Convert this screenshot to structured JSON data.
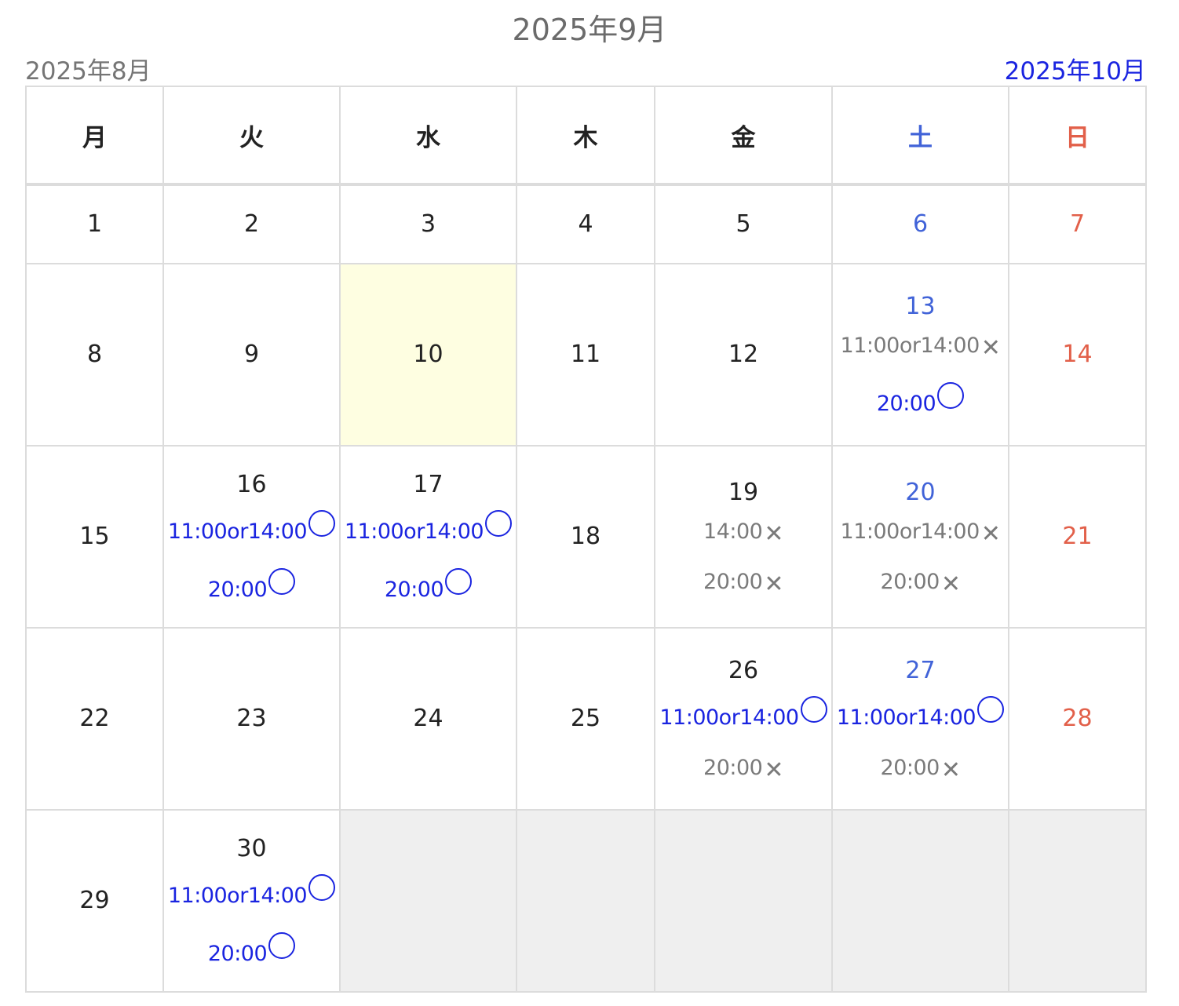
{
  "header": {
    "title": "2025年9月",
    "prev_label": "2025年8月",
    "next_label": "2025年10月"
  },
  "weekdays": [
    "月",
    "火",
    "水",
    "木",
    "金",
    "土",
    "日"
  ],
  "colors": {
    "available": "#1a24e0",
    "full": "#7a7a7a",
    "saturday": "#4163d8",
    "sunday": "#e2604a",
    "today_bg": "#fefee1",
    "empty_bg": "#efefef"
  },
  "legend_marks": {
    "available": "○",
    "full": "✕"
  },
  "weeks": [
    [
      {
        "day": "1"
      },
      {
        "day": "2"
      },
      {
        "day": "3"
      },
      {
        "day": "4"
      },
      {
        "day": "5"
      },
      {
        "day": "6"
      },
      {
        "day": "7"
      }
    ],
    [
      {
        "day": "8"
      },
      {
        "day": "9"
      },
      {
        "day": "10",
        "today": true
      },
      {
        "day": "11"
      },
      {
        "day": "12"
      },
      {
        "day": "13",
        "slots": [
          {
            "time": "11:00or14:00",
            "status": "full"
          },
          {
            "time": "20:00",
            "status": "available"
          }
        ]
      },
      {
        "day": "14"
      }
    ],
    [
      {
        "day": "15"
      },
      {
        "day": "16",
        "slots": [
          {
            "time": "11:00or14:00",
            "status": "available"
          },
          {
            "time": "20:00",
            "status": "available"
          }
        ]
      },
      {
        "day": "17",
        "slots": [
          {
            "time": "11:00or14:00",
            "status": "available"
          },
          {
            "time": "20:00",
            "status": "available"
          }
        ]
      },
      {
        "day": "18"
      },
      {
        "day": "19",
        "slots": [
          {
            "time": "14:00",
            "status": "full"
          },
          {
            "time": "20:00",
            "status": "full"
          }
        ]
      },
      {
        "day": "20",
        "slots": [
          {
            "time": "11:00or14:00",
            "status": "full"
          },
          {
            "time": "20:00",
            "status": "full"
          }
        ]
      },
      {
        "day": "21"
      }
    ],
    [
      {
        "day": "22"
      },
      {
        "day": "23"
      },
      {
        "day": "24"
      },
      {
        "day": "25"
      },
      {
        "day": "26",
        "slots": [
          {
            "time": "11:00or14:00",
            "status": "available"
          },
          {
            "time": "20:00",
            "status": "full"
          }
        ]
      },
      {
        "day": "27",
        "slots": [
          {
            "time": "11:00or14:00",
            "status": "available"
          },
          {
            "time": "20:00",
            "status": "full"
          }
        ]
      },
      {
        "day": "28"
      }
    ],
    [
      {
        "day": "29"
      },
      {
        "day": "30",
        "slots": [
          {
            "time": "11:00or14:00",
            "status": "available"
          },
          {
            "time": "20:00",
            "status": "available"
          }
        ]
      },
      {
        "empty": true
      },
      {
        "empty": true
      },
      {
        "empty": true
      },
      {
        "empty": true
      },
      {
        "empty": true
      }
    ]
  ]
}
